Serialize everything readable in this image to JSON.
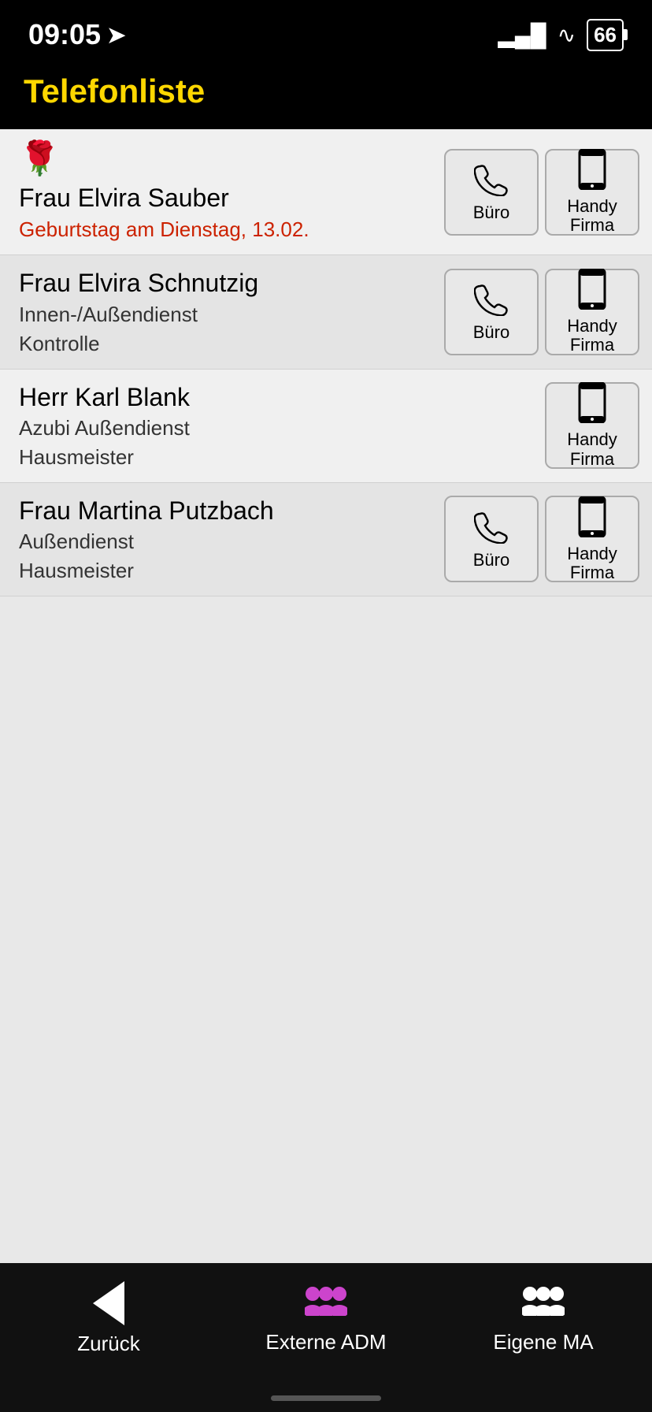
{
  "statusBar": {
    "time": "09:05",
    "battery": "66",
    "locationArrow": "➤"
  },
  "header": {
    "title": "Telefonliste"
  },
  "contacts": [
    {
      "id": 1,
      "hasRose": true,
      "name": "Frau Elvira Sauber",
      "birthday": "Geburtstag am Dienstag, 13.02.",
      "dept": null,
      "sub": null,
      "buttons": [
        "buero",
        "handy-firma"
      ]
    },
    {
      "id": 2,
      "hasRose": false,
      "name": "Frau Elvira Schnutzig",
      "birthday": null,
      "dept": "Innen-/Außendienst",
      "sub": "Kontrolle",
      "buttons": [
        "buero",
        "handy-firma"
      ]
    },
    {
      "id": 3,
      "hasRose": false,
      "name": "Herr Karl Blank",
      "birthday": null,
      "dept": "Azubi Außendienst",
      "sub": "Hausmeister",
      "buttons": [
        "handy-firma"
      ]
    },
    {
      "id": 4,
      "hasRose": false,
      "name": "Frau Martina Putzbach",
      "birthday": null,
      "dept": "Außendienst",
      "sub": "Hausmeister",
      "buttons": [
        "buero",
        "handy-firma"
      ]
    }
  ],
  "buttons": {
    "buero": {
      "label": "Büro"
    },
    "handyFirma": {
      "line1": "Handy",
      "line2": "Firma"
    }
  },
  "tabBar": {
    "back": "Zurück",
    "externeADM": "Externe ADM",
    "eigenMA": "Eigene MA"
  }
}
